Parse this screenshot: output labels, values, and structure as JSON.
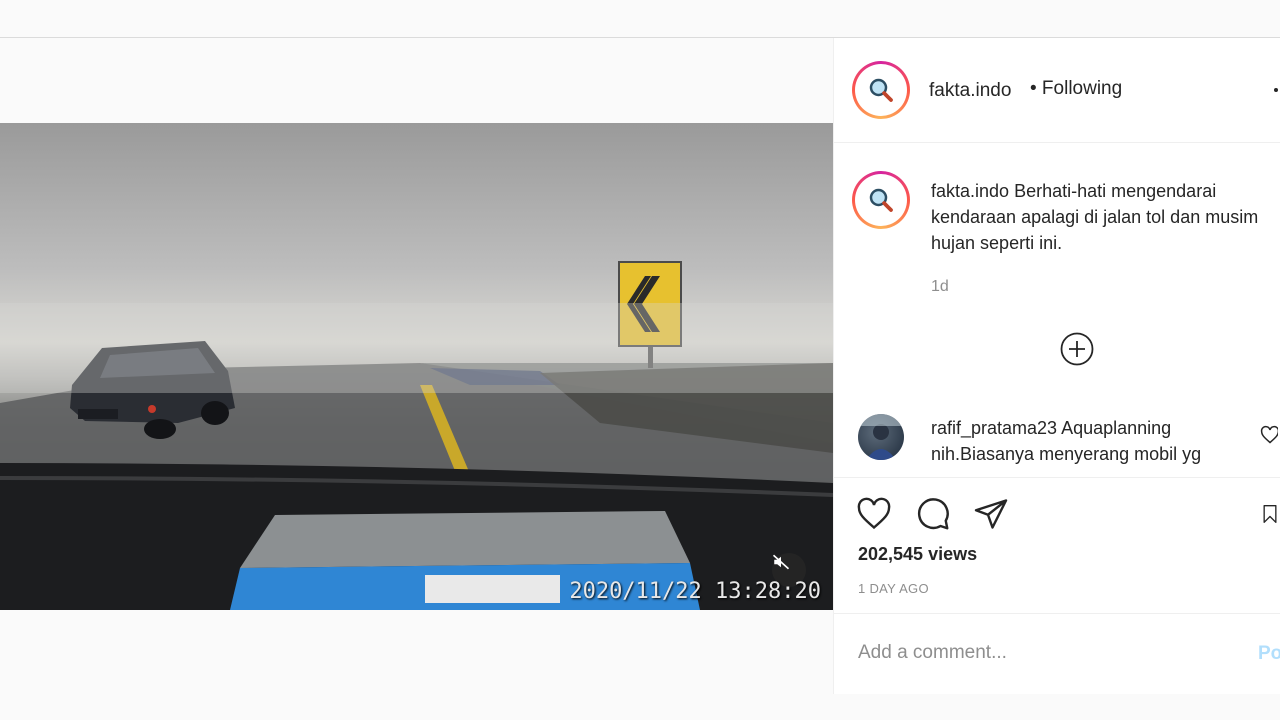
{
  "post": {
    "username": "fakta.indo",
    "follow_status": "• Following",
    "caption": "Berhati-hati mengendarai kendaraan apalagi di jalan tol dan musim hujan seperti ini.",
    "time_ago": "1d",
    "views": "202,545 views",
    "date": "1 DAY AGO",
    "video_timestamp": "2020/11/22  13:28:20"
  },
  "comment": {
    "username": "rafif_pratama23",
    "text": "Aquaplanning nih.Biasanya menyerang mobil yg"
  },
  "comment_bar": {
    "placeholder": "Add a comment...",
    "post_label": "Post"
  },
  "icons": {
    "avatar": "magnifier-icon",
    "more": "more-icon",
    "load_more": "plus-circle-icon",
    "like": "heart-icon",
    "comment": "comment-icon",
    "share": "send-icon",
    "save": "bookmark-icon",
    "mute": "muted-speaker-icon"
  },
  "colors": {
    "link_disabled": "#b2dffc",
    "secondary_text": "#8e8e8e",
    "border": "#dbdbdb"
  }
}
